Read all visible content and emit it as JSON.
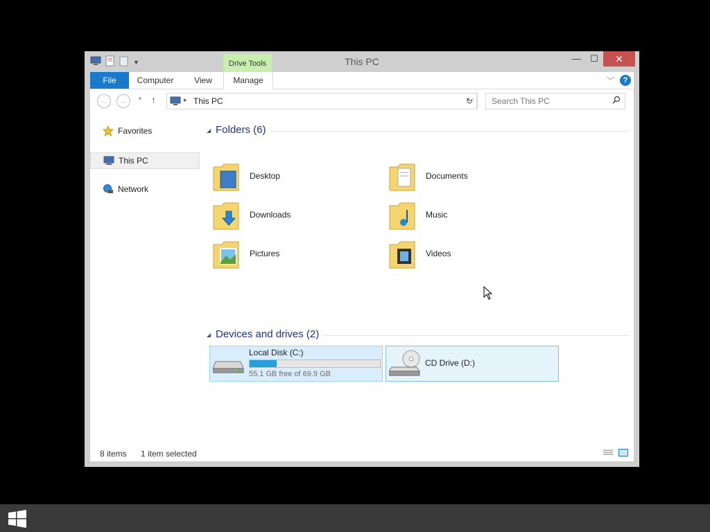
{
  "window": {
    "title": "This PC",
    "context_tab": "Drive Tools",
    "controls": {
      "minimize": "—",
      "maximize": "☐",
      "close": "✕"
    }
  },
  "ribbon": {
    "tabs": [
      {
        "label": "File"
      },
      {
        "label": "Computer"
      },
      {
        "label": "View"
      },
      {
        "label": "Manage"
      }
    ],
    "help": "?"
  },
  "navbar": {
    "address": "This PC",
    "search_placeholder": "Search This PC"
  },
  "navpane": {
    "items": [
      {
        "label": "Favorites",
        "icon": "star-icon"
      },
      {
        "label": "This PC",
        "icon": "computer-icon",
        "selected": true
      },
      {
        "label": "Network",
        "icon": "network-icon"
      }
    ]
  },
  "groups": {
    "folders": {
      "title": "Folders (6)",
      "items": [
        {
          "label": "Desktop",
          "icon": "desktop-folder-icon"
        },
        {
          "label": "Documents",
          "icon": "documents-folder-icon"
        },
        {
          "label": "Downloads",
          "icon": "downloads-folder-icon"
        },
        {
          "label": "Music",
          "icon": "music-folder-icon"
        },
        {
          "label": "Pictures",
          "icon": "pictures-folder-icon"
        },
        {
          "label": "Videos",
          "icon": "videos-folder-icon"
        }
      ]
    },
    "drives": {
      "title": "Devices and drives (2)",
      "items": [
        {
          "label": "Local Disk (C:)",
          "free_text": "55.1 GB free of 69.9 GB",
          "used_fraction": 0.21,
          "icon": "hard-disk-icon"
        },
        {
          "label": "CD Drive (D:)",
          "icon": "cd-drive-icon"
        }
      ]
    }
  },
  "status": {
    "count": "8 items",
    "selected": "1 item selected"
  },
  "colors": {
    "accent": "#1979ca",
    "group_header": "#1e3287",
    "selection": "#d9edfb",
    "context_tab": "#c9efb0"
  }
}
